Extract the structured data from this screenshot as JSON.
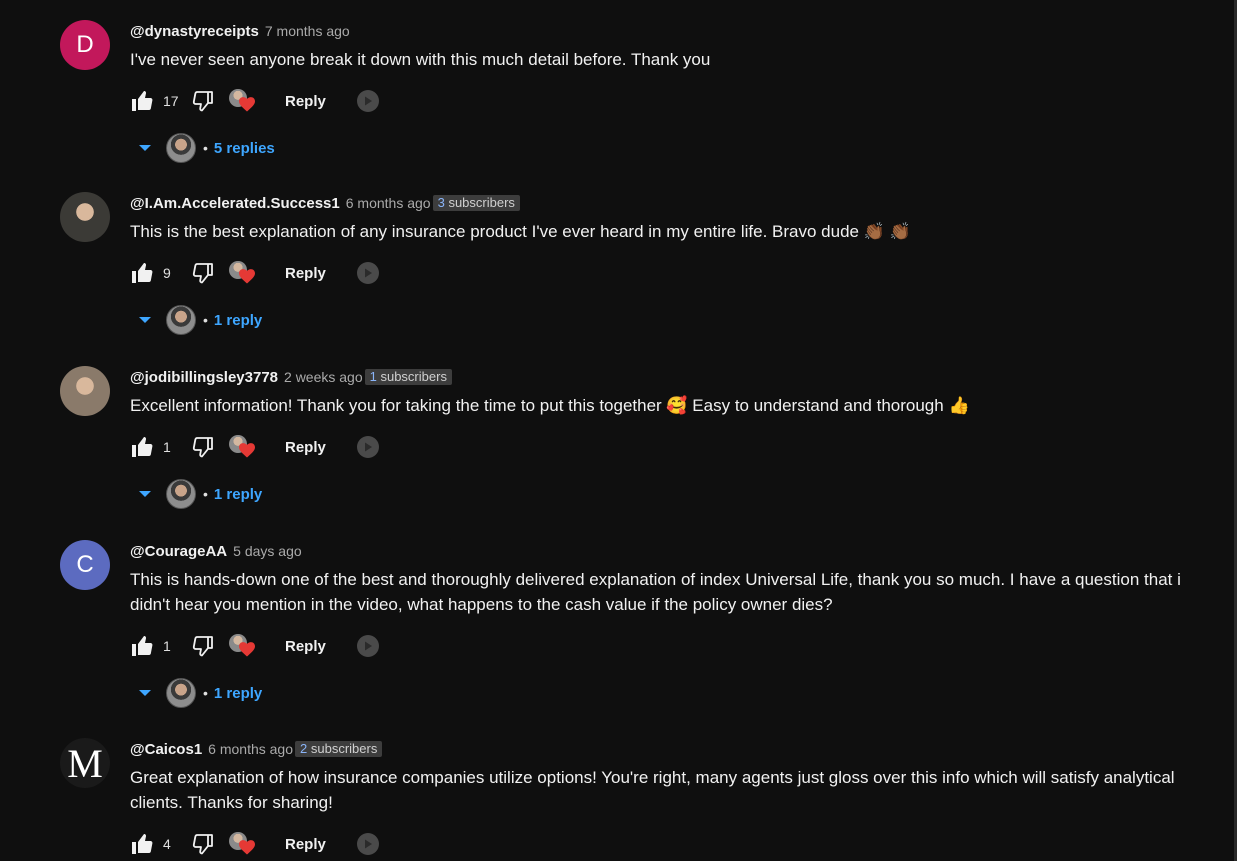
{
  "comments": [
    {
      "handle": "@dynastyreceipts",
      "time": "7 months ago",
      "subscribers": null,
      "text": "I've never seen anyone break it down with this much detail before. Thank you",
      "likes": "17",
      "reply_label": "Reply",
      "replies_label": "5 replies",
      "avatar_letter": "D",
      "avatar_color": "#c2185b"
    },
    {
      "handle": "@I.Am.Accelerated.Success1",
      "time": "6 months ago",
      "subscribers": {
        "count": "3",
        "suffix": " subscribers"
      },
      "text": "This is the best explanation of any insurance product I've ever heard in my entire life. Bravo dude 👏🏾 👏🏾",
      "likes": "9",
      "reply_label": "Reply",
      "replies_label": "1 reply",
      "avatar_letter": "",
      "avatar_color": "#3b3a36"
    },
    {
      "handle": "@jodibillingsley3778",
      "time": "2 weeks ago",
      "subscribers": {
        "count": "1",
        "suffix": " subscribers"
      },
      "text": "Excellent information! Thank you for taking the time to put this together 🥰 Easy to understand and thorough 👍",
      "likes": "1",
      "reply_label": "Reply",
      "replies_label": "1 reply",
      "avatar_letter": "",
      "avatar_color": "#8a7a6a"
    },
    {
      "handle": "@CourageAA",
      "time": "5 days ago",
      "subscribers": null,
      "text": "This is hands-down one of the best and thoroughly delivered explanation of index Universal Life, thank you so much. I have a question that i didn't hear you mention in the video,  what happens to the cash value if the policy owner dies?",
      "likes": "1",
      "reply_label": "Reply",
      "replies_label": "1 reply",
      "avatar_letter": "C",
      "avatar_color": "#5c6bc0"
    },
    {
      "handle": "@Caicos1",
      "time": "6 months ago",
      "subscribers": {
        "count": "2",
        "suffix": " subscribers"
      },
      "text": "Great explanation of how insurance companies utilize options! You're right, many agents just gloss over this info which will satisfy analytical clients. Thanks for sharing!",
      "likes": "4",
      "reply_label": "Reply",
      "replies_label": "",
      "avatar_letter": "M",
      "avatar_color": "#1a1a1a"
    }
  ],
  "colors": {
    "background": "#0f0f0f",
    "link": "#3ea6ff",
    "heart": "#e53935"
  }
}
